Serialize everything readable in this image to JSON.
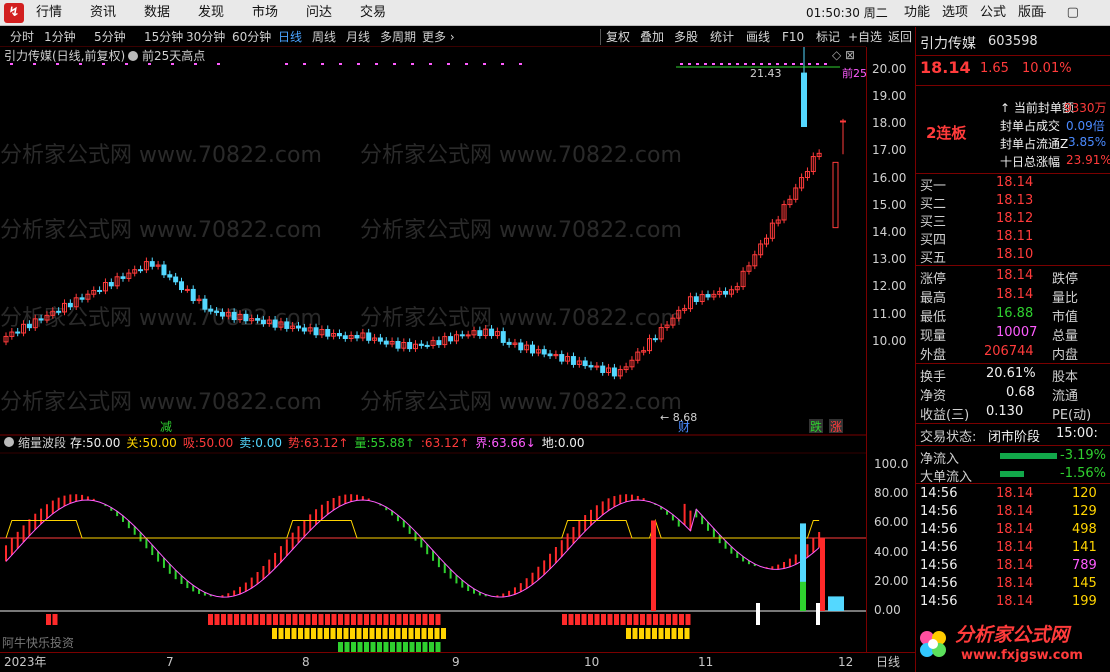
{
  "topbar": {
    "logo": "↯",
    "menus": [
      "行情",
      "资讯",
      "数据",
      "发现",
      "市场",
      "问达",
      "交易"
    ],
    "clock": "01:50:30 周二",
    "right_menus": [
      "功能",
      "选项",
      "公式",
      "版面"
    ],
    "window_buttons": "– ▢ ✕"
  },
  "periods": [
    "分时",
    "1分钟",
    "5分钟",
    "15分钟",
    "30分钟",
    "60分钟",
    "日线",
    "周线",
    "月线",
    "多周期",
    "更多 ›"
  ],
  "selected_period": "日线",
  "tools": [
    "复权",
    "叠加",
    "多股",
    "统计",
    "画线",
    "F10",
    "标记",
    "+自选",
    "返回"
  ],
  "main_chart": {
    "title": "引力传媒(日线,前复权)",
    "indicator": "前25天高点",
    "y_ticks": [
      "20.00",
      "19.00",
      "18.00",
      "17.00",
      "16.00",
      "15.00",
      "14.00",
      "13.00",
      "12.00",
      "11.00",
      "10.00"
    ],
    "annotations": {
      "high": "21.43",
      "low": "8.68",
      "marker_cai": "财",
      "marker_jian": "减",
      "marker_die": "跌",
      "marker_zhang": "涨",
      "right_label": "前25"
    },
    "watermark": "分析家公式网 www.70822.com"
  },
  "sub_chart": {
    "name": "缩量波段",
    "params": [
      {
        "label": "存:",
        "value": "50.00",
        "color": "#f0f0f0"
      },
      {
        "label": "关:",
        "value": "50.00",
        "color": "#ffd400"
      },
      {
        "label": "吸:",
        "value": "50.00",
        "color": "#ff3b3b"
      },
      {
        "label": "卖:",
        "value": "0.00",
        "color": "#54d8ff"
      },
      {
        "label": "势:",
        "value": "63.12↑",
        "color": "#ff3b3b"
      },
      {
        "label": "量:",
        "value": "55.88↑",
        "color": "#2fd12f"
      },
      {
        "label": ":",
        "value": "63.12↑",
        "color": "#ff3b3b"
      },
      {
        "label": "界:",
        "value": "63.66↓",
        "color": "#ff5cff"
      },
      {
        "label": "地:",
        "value": "0.00",
        "color": "#f0f0f0"
      }
    ],
    "y_ticks": [
      "100.0",
      "80.00",
      "60.00",
      "40.00",
      "20.00",
      "0.00"
    ],
    "footer": "阿牛快乐投资"
  },
  "x_axis": [
    "2023年",
    "7",
    "8",
    "9",
    "10",
    "11",
    "12"
  ],
  "x_axis_right": "日线",
  "stock": {
    "name": "引力传媒",
    "code": "603598",
    "price": "18.14",
    "change": "1.65",
    "pct": "10.01%",
    "tag": "2连板",
    "seal": [
      {
        "label": "当前封单额",
        "value": "9330万"
      },
      {
        "label": "封单占成交",
        "value": "0.09倍"
      },
      {
        "label": "封单占流通Z",
        "value": "3.85%"
      },
      {
        "label": "十日总涨幅",
        "value": "23.91%"
      }
    ],
    "bids": [
      {
        "label": "买一",
        "price": "18.14"
      },
      {
        "label": "买二",
        "price": "18.13"
      },
      {
        "label": "买三",
        "price": "18.12"
      },
      {
        "label": "买四",
        "price": "18.11"
      },
      {
        "label": "买五",
        "price": "18.10"
      }
    ],
    "quote": [
      {
        "l": "涨停",
        "v": "18.14",
        "r": "跌停"
      },
      {
        "l": "最高",
        "v": "18.14",
        "r": "量比"
      },
      {
        "l": "最低",
        "v": "16.88",
        "r": "市值"
      },
      {
        "l": "现量",
        "v": "10007",
        "r": "总量"
      },
      {
        "l": "外盘",
        "v": "206744",
        "r": "内盘"
      }
    ],
    "fund": [
      {
        "l": "换手",
        "v": "20.61%",
        "r": "股本"
      },
      {
        "l": "净资",
        "v": "0.68",
        "r": "流通"
      },
      {
        "l": "收益(三)",
        "v": "0.130",
        "r": "PE(动)"
      }
    ],
    "status_label": "交易状态:",
    "status": "闭市阶段",
    "status_time": "15:00:",
    "flows": [
      {
        "l": "净流入",
        "v": "-3.19%",
        "fill": 0.57
      },
      {
        "l": "大单流入",
        "v": "-1.56%",
        "fill": 0.24
      }
    ],
    "ticks": [
      {
        "t": "14:56",
        "p": "18.14",
        "v": "120"
      },
      {
        "t": "14:56",
        "p": "18.14",
        "v": "129"
      },
      {
        "t": "14:56",
        "p": "18.14",
        "v": "498"
      },
      {
        "t": "14:56",
        "p": "18.14",
        "v": "141"
      },
      {
        "t": "14:56",
        "p": "18.14",
        "v": "789"
      },
      {
        "t": "14:56",
        "p": "18.14",
        "v": "145"
      },
      {
        "t": "14:56",
        "p": "18.14",
        "v": "199"
      }
    ]
  },
  "badge": {
    "title": "分析家公式网",
    "url": "www.fxjgsw.com"
  }
}
